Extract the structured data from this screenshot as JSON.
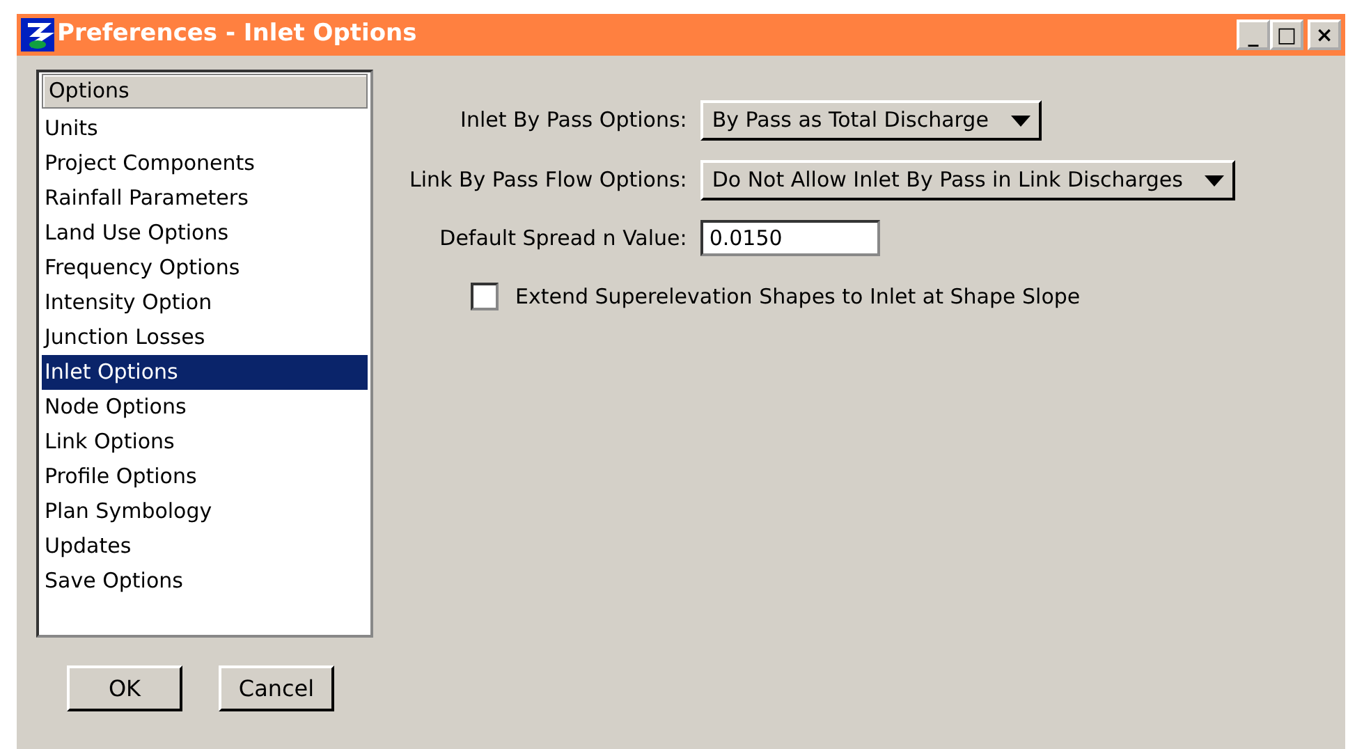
{
  "window": {
    "title": "Preferences - Inlet Options",
    "controls": [
      "_",
      "□",
      "×"
    ]
  },
  "options_list": {
    "header": "Options",
    "items": [
      {
        "label": "Units",
        "selected": false
      },
      {
        "label": "Project Components",
        "selected": false
      },
      {
        "label": "Rainfall Parameters",
        "selected": false
      },
      {
        "label": "Land Use Options",
        "selected": false
      },
      {
        "label": "Frequency Options",
        "selected": false
      },
      {
        "label": "Intensity Option",
        "selected": false
      },
      {
        "label": "Junction Losses",
        "selected": false
      },
      {
        "label": "Inlet Options",
        "selected": true
      },
      {
        "label": "Node Options",
        "selected": false
      },
      {
        "label": "Link Options",
        "selected": false
      },
      {
        "label": "Profile Options",
        "selected": false
      },
      {
        "label": "Plan Symbology",
        "selected": false
      },
      {
        "label": "Updates",
        "selected": false
      },
      {
        "label": "Save Options",
        "selected": false
      }
    ]
  },
  "fields": [
    {
      "kind": "dropdown",
      "label": "Inlet By Pass Options:",
      "value": "By Pass as Total Discharge"
    },
    {
      "kind": "dropdown",
      "label": "Link By Pass Flow Options:",
      "value": "Do Not Allow Inlet By Pass in Link Discharges"
    },
    {
      "kind": "text",
      "label": "Default Spread n Value:",
      "value": "0.0150"
    }
  ],
  "checkbox": {
    "label": "Extend Superelevation Shapes to Inlet at Shape Slope",
    "checked": false
  },
  "buttons": [
    "OK",
    "Cancel"
  ]
}
